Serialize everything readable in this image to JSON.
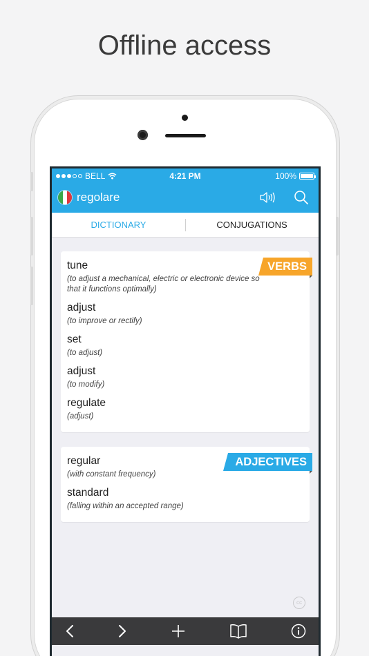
{
  "headline": "Offline access",
  "status_bar": {
    "carrier": "BELL",
    "time": "4:21 PM",
    "battery": "100%"
  },
  "nav": {
    "title": "regolare"
  },
  "tabs": [
    {
      "label": "DICTIONARY",
      "active": true
    },
    {
      "label": "CONJUGATIONS",
      "active": false
    }
  ],
  "sections": [
    {
      "tag": "VERBS",
      "tag_color": "#f7a52a",
      "entries": [
        {
          "word": "tune",
          "gloss": "(to adjust a mechanical, electric or electronic device so that it functions optimally)"
        },
        {
          "word": "adjust",
          "gloss": "(to improve or rectify)"
        },
        {
          "word": "set",
          "gloss": "(to adjust)"
        },
        {
          "word": "adjust",
          "gloss": "(to modify)"
        },
        {
          "word": "regulate",
          "gloss": "(adjust)"
        }
      ]
    },
    {
      "tag": "ADJECTIVES",
      "tag_color": "#2aaae6",
      "entries": [
        {
          "word": "regular",
          "gloss": "(with constant frequency)"
        },
        {
          "word": "standard",
          "gloss": "(falling within an accepted range)"
        }
      ]
    }
  ],
  "cc_badge": "cc",
  "toolbar": {
    "icons": [
      "back-icon",
      "forward-icon",
      "add-icon",
      "bookmarks-icon",
      "info-icon"
    ]
  },
  "colors": {
    "accent": "#2aaae6",
    "verbs_tag": "#f7a52a",
    "toolbar": "#3a3a3c"
  }
}
